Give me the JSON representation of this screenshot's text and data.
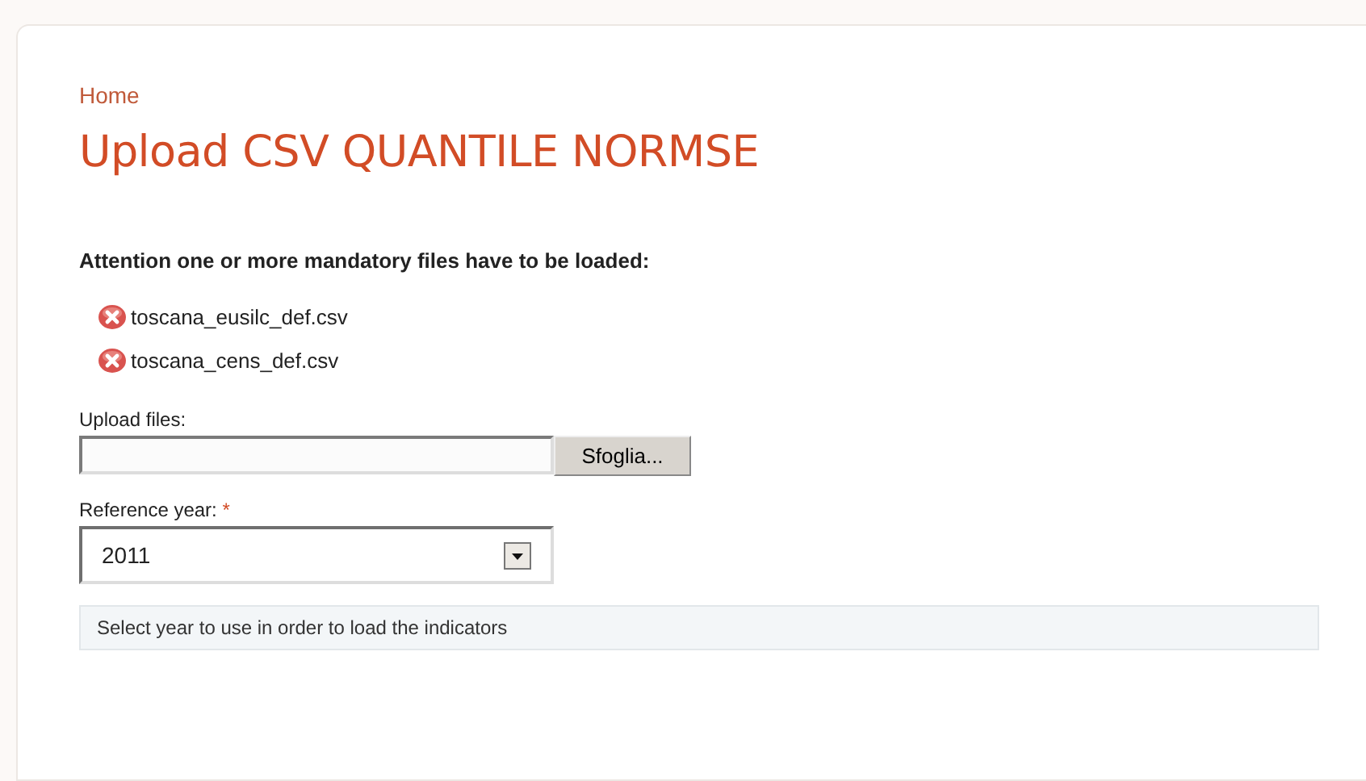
{
  "breadcrumb": "Home",
  "title": "Upload CSV QUANTILE NORMSE",
  "warning": "Attention one or more mandatory files have to be loaded:",
  "missing_files": [
    {
      "name": "toscana_eusilc_def.csv"
    },
    {
      "name": "toscana_cens_def.csv"
    }
  ],
  "upload": {
    "label": "Upload files:",
    "button": "Sfoglia..."
  },
  "reference_year": {
    "label": "Reference year:",
    "required_mark": "*",
    "value": "2011",
    "description": "Select year to use in order to load the indicators"
  }
}
